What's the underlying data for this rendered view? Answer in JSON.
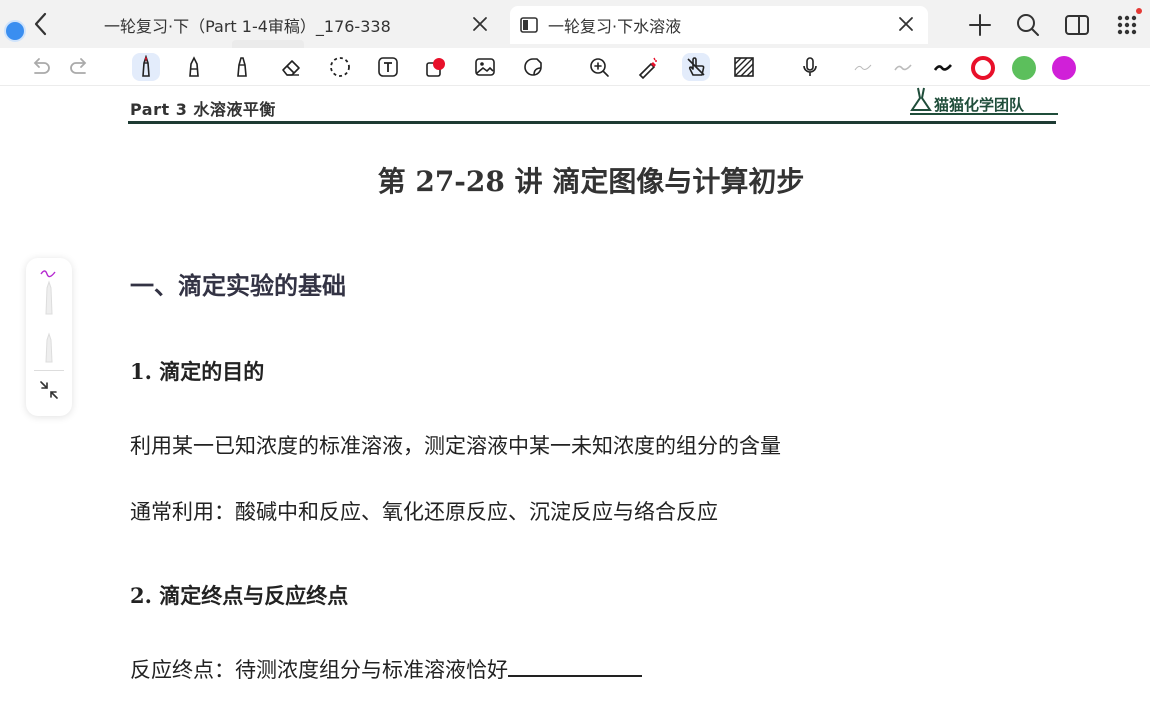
{
  "tabs": [
    {
      "label": "一轮复习·下（Part 1-4审稿）_176-338",
      "active": false
    },
    {
      "label": "一轮复习·下水溶液",
      "active": true
    }
  ],
  "icons": {
    "back": "chevron-left-icon",
    "close": "close-icon",
    "new_tab": "plus-icon",
    "search": "search-icon",
    "layout": "sidebar-layout-icon",
    "apps": "grid-apps-icon"
  },
  "toolbar": {
    "tools": [
      "undo-icon",
      "redo-icon",
      "pen-icon",
      "fountain-pen-icon",
      "highlighter-icon",
      "eraser-icon",
      "lasso-icon",
      "text-box-icon",
      "shapes-icon",
      "image-icon",
      "sticker-icon",
      "zoom-in-icon",
      "laser-pointer-icon",
      "touch-hand-icon",
      "pattern-fill-icon",
      "microphone-icon",
      "stroke-thin-icon",
      "stroke-medium-icon",
      "stroke-thick-icon"
    ],
    "colors": [
      "#e8102a",
      "#5cbf5c",
      "#d020d8"
    ],
    "active_tool": "pen-icon"
  },
  "document": {
    "header_left": "Part 3  水溶液平衡",
    "header_right": "猫猫化学团队",
    "title": "第 27-28 讲  滴定图像与计算初步",
    "section": "一、滴定实验的基础",
    "subsection1": "1.   滴定的目的",
    "para1": "利用某一已知浓度的标准溶液，测定溶液中某一未知浓度的组分的含量",
    "para2": "通常利用：酸碱中和反应、氧化还原反应、沉淀反应与络合反应",
    "subsection2": "2.   滴定终点与反应终点",
    "para3": "反应终点：待测浓度组分与标准溶液恰好"
  },
  "side_panel": [
    "pen-preset-purple-icon",
    "pen-preset-gray-icon",
    "collapse-icon"
  ]
}
